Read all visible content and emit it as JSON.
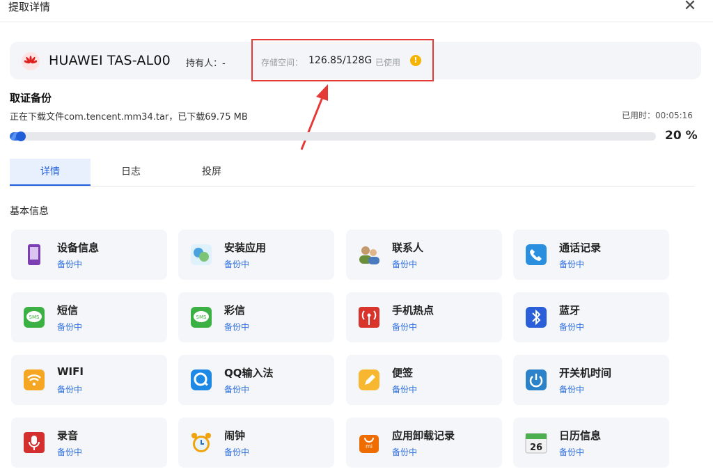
{
  "window": {
    "title": "提取详情",
    "close_glyph": "✕"
  },
  "device": {
    "name": "HUAWEI TAS-AL00",
    "holder": "持有人：-",
    "storage_label": "存储空间：",
    "storage_value": "126.85/128G",
    "storage_used": "已使用",
    "warning_icon": "!"
  },
  "backup": {
    "section_title": "取证备份",
    "status": "正在下载文件com.tencent.mm34.tar，已下载69.75 MB",
    "elapsed": "已用时：00:05:16",
    "progress": 0.2,
    "progress_label": "20 %"
  },
  "tabs": [
    {
      "label": "详情",
      "active": true
    },
    {
      "label": "日志",
      "active": false
    },
    {
      "label": "投屏",
      "active": false
    }
  ],
  "basic_info_title": "基本信息",
  "items": [
    {
      "name": "设备信息",
      "status": "备份中",
      "icon": "phone-icon",
      "color": "#7b3fb3"
    },
    {
      "name": "安装应用",
      "status": "备份中",
      "icon": "apps-icon",
      "color": "#4aa3df"
    },
    {
      "name": "联系人",
      "status": "备份中",
      "icon": "contacts-icon",
      "color": "#6b8e3a"
    },
    {
      "name": "通话记录",
      "status": "备份中",
      "icon": "call-log-icon",
      "color": "#2b8fe0"
    },
    {
      "name": "短信",
      "status": "备份中",
      "icon": "sms-icon",
      "color": "#3cb043"
    },
    {
      "name": "彩信",
      "status": "备份中",
      "icon": "mms-icon",
      "color": "#3cb043"
    },
    {
      "name": "手机热点",
      "status": "备份中",
      "icon": "hotspot-icon",
      "color": "#d9342b"
    },
    {
      "name": "蓝牙",
      "status": "备份中",
      "icon": "bluetooth-icon",
      "color": "#2b5fd9"
    },
    {
      "name": "WIFI",
      "status": "备份中",
      "icon": "wifi-icon",
      "color": "#f5a623"
    },
    {
      "name": "QQ输入法",
      "status": "备份中",
      "icon": "qq-input-icon",
      "color": "#1e88e5"
    },
    {
      "name": "便签",
      "status": "备份中",
      "icon": "notes-icon",
      "color": "#f7b731"
    },
    {
      "name": "开关机时间",
      "status": "备份中",
      "icon": "power-icon",
      "color": "#2c82c9"
    },
    {
      "name": "录音",
      "status": "备份中",
      "icon": "microphone-icon",
      "color": "#d32f2f"
    },
    {
      "name": "闹钟",
      "status": "备份中",
      "icon": "alarm-clock-icon",
      "color": "#f0a30a"
    },
    {
      "name": "应用卸载记录",
      "status": "备份中",
      "icon": "uninstall-icon",
      "color": "#ef6c00"
    },
    {
      "name": "日历信息",
      "status": "备份中",
      "icon": "calendar-icon",
      "color": "#4caf50",
      "icon_text": "26"
    }
  ]
}
